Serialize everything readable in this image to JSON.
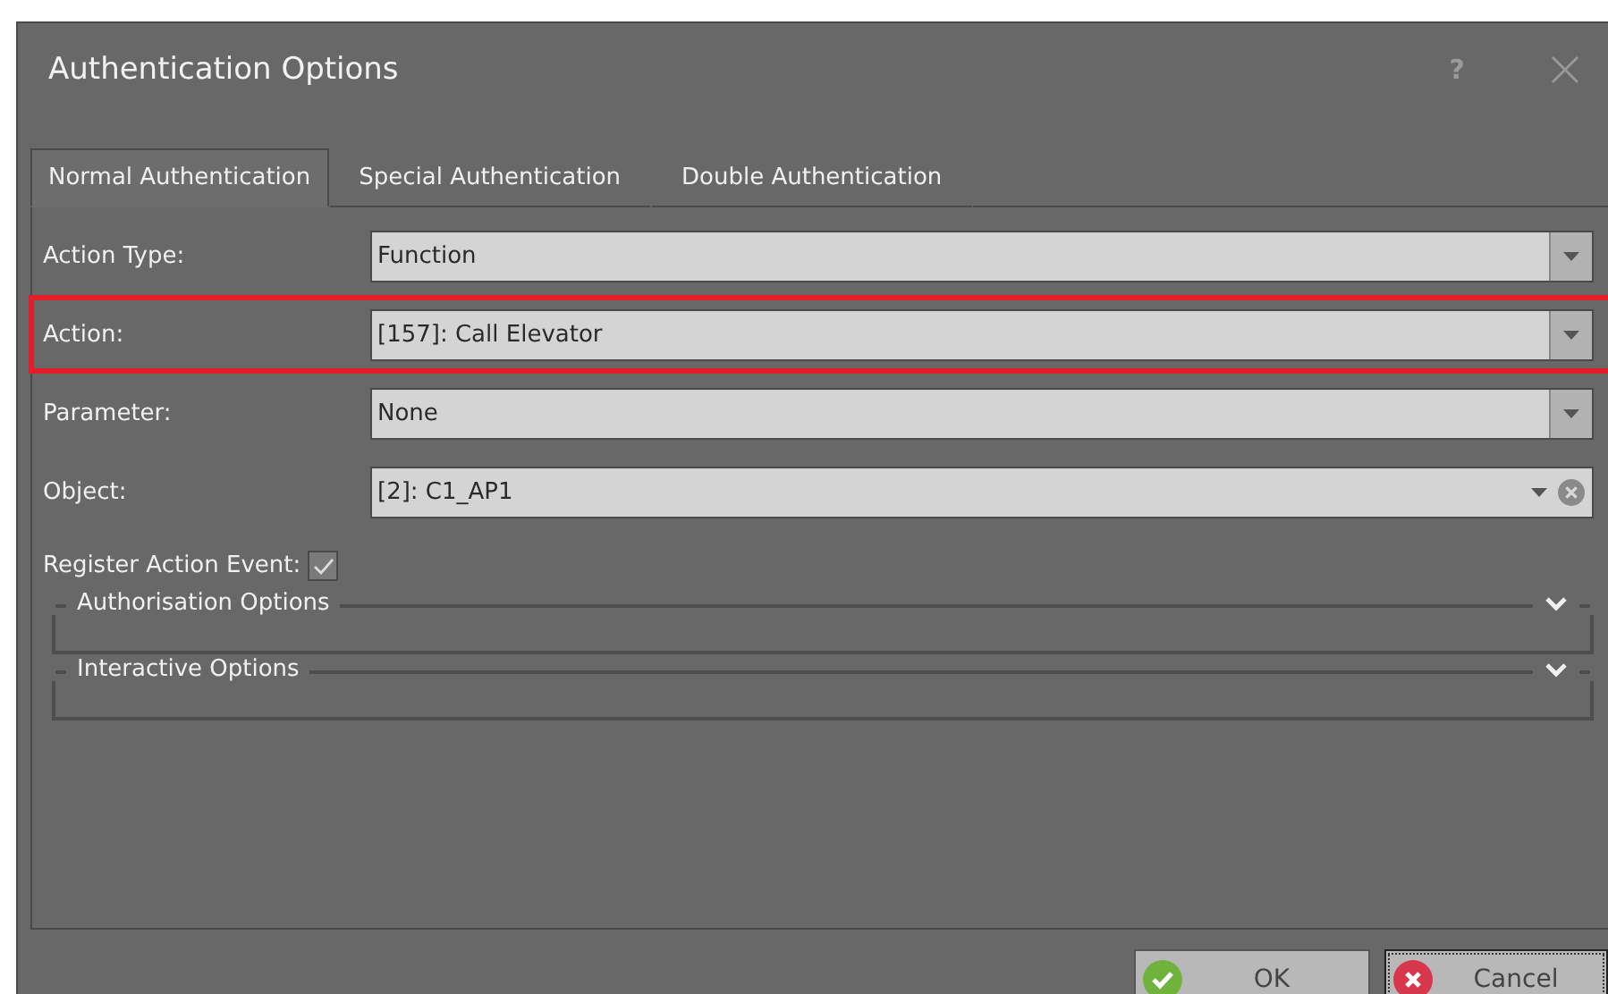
{
  "window": {
    "title": "Authentication Options",
    "help": "?"
  },
  "tabs": [
    {
      "label": "Normal Authentication",
      "selected": true
    },
    {
      "label": "Special Authentication",
      "selected": false
    },
    {
      "label": "Double Authentication",
      "selected": false
    }
  ],
  "fields": [
    {
      "label": "Action Type:",
      "value": "Function",
      "kind": "dropdown",
      "highlighted": false
    },
    {
      "label": "Action:",
      "value": "[157]: Call Elevator",
      "kind": "dropdown",
      "highlighted": true
    },
    {
      "label": "Parameter:",
      "value": "None",
      "kind": "dropdown",
      "highlighted": false
    },
    {
      "label": "Object:",
      "value": "[2]: C1_AP1",
      "kind": "clearable",
      "highlighted": false
    }
  ],
  "register_event": {
    "label": "Register Action Event:",
    "checked": true
  },
  "groups": [
    {
      "title": "Authorisation Options",
      "expanded": false
    },
    {
      "title": "Interactive Options",
      "expanded": false
    }
  ],
  "buttons": [
    {
      "label": "OK",
      "kind": "ok",
      "focused": false
    },
    {
      "label": "Cancel",
      "kind": "cancel",
      "focused": true
    }
  ]
}
